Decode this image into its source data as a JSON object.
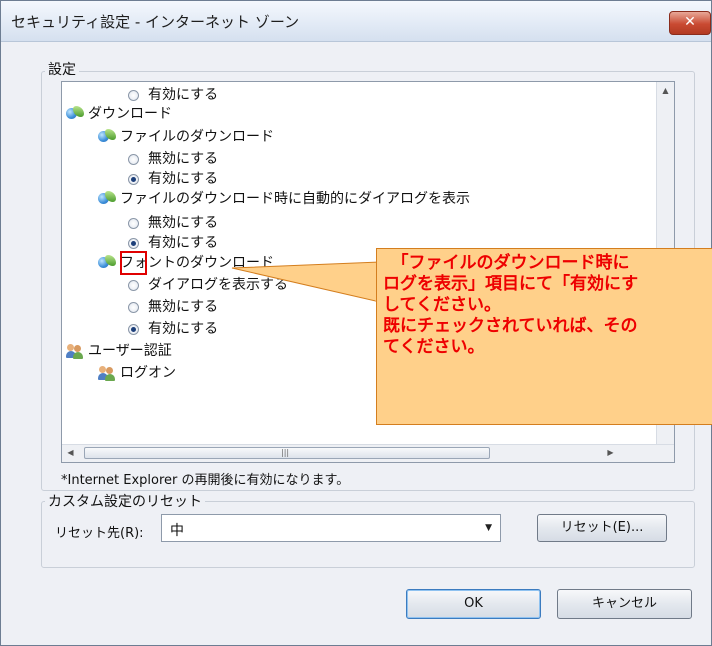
{
  "window": {
    "title": "セキュリティ設定 - インターネット ゾーン",
    "close_label": "✕"
  },
  "settings": {
    "group_label": "設定",
    "tree": [
      {
        "type": "radio",
        "label": "有効にする",
        "checked": false,
        "level": 2
      },
      {
        "type": "zone",
        "label": "ダウンロード",
        "level": 0
      },
      {
        "type": "zone",
        "label": "ファイルのダウンロード",
        "level": 1
      },
      {
        "type": "radio",
        "label": "無効にする",
        "checked": false,
        "level": 2
      },
      {
        "type": "radio",
        "label": "有効にする",
        "checked": true,
        "level": 2
      },
      {
        "type": "zone",
        "label": "ファイルのダウンロード時に自動的にダイアログを表示",
        "level": 1
      },
      {
        "type": "radio",
        "label": "無効にする",
        "checked": false,
        "level": 2
      },
      {
        "type": "radio",
        "label": "有効にする",
        "checked": true,
        "level": 2
      },
      {
        "type": "zone",
        "label": "フォントのダウンロード",
        "level": 1
      },
      {
        "type": "radio",
        "label": "ダイアログを表示する",
        "checked": false,
        "level": 2
      },
      {
        "type": "radio",
        "label": "無効にする",
        "checked": false,
        "level": 2
      },
      {
        "type": "radio",
        "label": "有効にする",
        "checked": true,
        "level": 2
      },
      {
        "type": "user",
        "label": "ユーザー認証",
        "level": 0
      },
      {
        "type": "user",
        "label": "ログオン",
        "level": 1
      }
    ],
    "note": "*Internet Explorer の再開後に有効になります。"
  },
  "reset": {
    "group_label": "カスタム設定のリセット",
    "target_label": "リセット先(R):",
    "target_value": "中",
    "reset_button": "リセット(E)..."
  },
  "buttons": {
    "ok": "OK",
    "cancel": "キャンセル"
  },
  "callout": {
    "lines": [
      "　「ファイルのダウンロード時に",
      "ログを表示」項目にて「有効にす",
      "してください。",
      "既にチェックされていれば、その",
      "てください。"
    ]
  },
  "icons": {
    "scroll_up": "up-arrow-icon",
    "scroll_left": "left-arrow-icon",
    "scroll_right": "right-arrow-icon",
    "dropdown": "chevron-down-icon"
  },
  "colors": {
    "callout_bg": "#ffd08a",
    "callout_text": "#ee0000",
    "highlight": "#e00000",
    "close_button": "#c94a32"
  }
}
